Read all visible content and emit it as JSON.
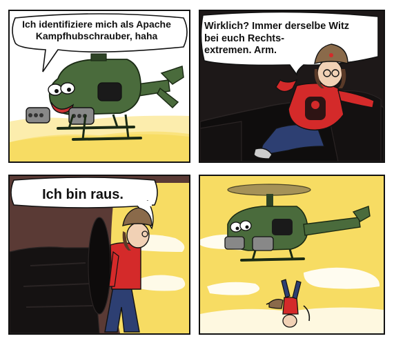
{
  "panels": [
    {
      "id": "panel-1",
      "speech": "Ich identifiziere mich als Apache Kampfhubschrauber, haha"
    },
    {
      "id": "panel-2",
      "speech": "Wirklich? Immer derselbe Witz bei euch Rechts-\nextremen. Arm."
    },
    {
      "id": "panel-3",
      "speech": "Ich bin raus."
    },
    {
      "id": "panel-4",
      "speech": ""
    }
  ],
  "colors": {
    "sky_yellow": "#f7dc63",
    "helicopter_green": "#4a6b3c",
    "helicopter_dark": "#2e4426",
    "shirt_red": "#d42a2a",
    "hat_brown": "#8a6a4a",
    "jeans_blue": "#2d3f72",
    "dark_bg": "#1d1818",
    "wall_brown": "#5a3a35"
  }
}
